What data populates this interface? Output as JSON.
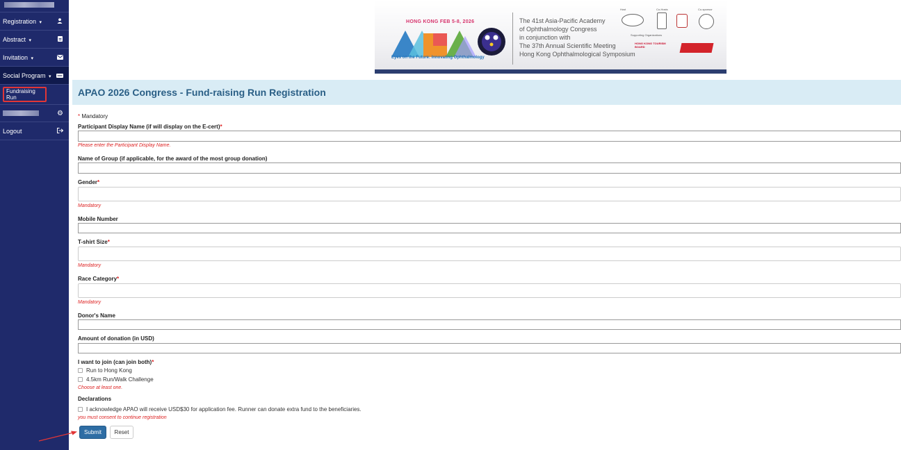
{
  "sidebar": {
    "items": [
      {
        "label": "Registration",
        "icon": "user-icon",
        "glyph": "👤",
        "has_caret": true
      },
      {
        "label": "Abstract",
        "icon": "document-icon",
        "glyph": "▤",
        "has_caret": true
      },
      {
        "label": "Invitation",
        "icon": "envelope-icon",
        "glyph": "✉",
        "has_caret": true
      },
      {
        "label": "Social Program",
        "icon": "card-icon",
        "glyph": "▬",
        "has_caret": true
      }
    ],
    "caret": "▾",
    "sub_item": "Fundraising Run",
    "settings_glyph": "⚙",
    "logout_label": "Logout",
    "logout_glyph": "↦"
  },
  "banner": {
    "date": "HONG KONG FEB 5-8, 2026",
    "logo_text": "APAO",
    "tagline": "Eyes on the Future: Innovating Ophthalmology",
    "lines": [
      "The 41st Asia-Pacific Academy",
      "of Ophthalmology Congress",
      "in conjunction with",
      "The 37th Annual Scientific Meeting",
      "Hong Kong Ophthalmological Symposium"
    ],
    "host_label": "Host",
    "cohosts_label": "Co-Hosts",
    "cosponsor_label": "Co-sponsor",
    "supporting_label": "Supporting Organizations",
    "hktb_label": "HONG KONG TOURISM BOARD"
  },
  "page": {
    "title": "APAO 2026 Congress - Fund-raising Run Registration"
  },
  "form": {
    "mandatory_star": "*",
    "mandatory_note": "Mandatory",
    "fields": {
      "display_name": {
        "label": "Participant Display Name (if will display on the E-cert)",
        "required": true,
        "error": "Please enter the Participant Display Name."
      },
      "group": {
        "label": "Name of Group (if applicable, for the award of the most group donation)"
      },
      "gender": {
        "label": "Gender",
        "required": true,
        "error": "Mandatory"
      },
      "mobile": {
        "label": "Mobile Number"
      },
      "tshirt": {
        "label": "T-shirt Size",
        "required": true,
        "error": "Mandatory"
      },
      "race": {
        "label": "Race Category",
        "required": true,
        "error": "Mandatory"
      },
      "donor": {
        "label": "Donor's Name"
      },
      "amount": {
        "label": "Amount of donation (in USD)"
      }
    },
    "join": {
      "label": "I want to join (can join both)",
      "options": [
        "Run to Hong Kong",
        "4.5km Run/Walk Challenge"
      ],
      "error": "Choose at least one."
    },
    "declarations": {
      "label": "Declarations",
      "text": "I acknowledge APAO will receive USD$30 for application fee. Runner can donate extra fund to the beneficiaries.",
      "error": "you must consent to continue registration"
    },
    "submit_label": "Submit",
    "reset_label": "Reset"
  },
  "colors": {
    "sidebar_bg": "#1f2a6b",
    "title_bg": "#d9ecf5",
    "title_text": "#2a5f86",
    "error": "#dd2222",
    "submit_bg": "#2e6da4",
    "highlight": "#e23636"
  }
}
